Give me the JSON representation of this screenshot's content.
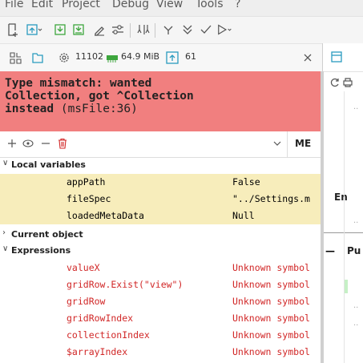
{
  "menu": {
    "items": [
      "File",
      "Edit",
      "Project",
      "Debug",
      "View",
      "Tools",
      "?"
    ]
  },
  "status": {
    "count": "11102",
    "memory": "64.9 MiB",
    "threads": "61"
  },
  "error": {
    "line1": "Type mismatch: wanted",
    "line2": "Collection, got ^Collection",
    "line3": "instead",
    "location": "(msFile:36)"
  },
  "panel": {
    "button_label": "ME"
  },
  "tree": {
    "local_header": "Local variables",
    "locals": [
      {
        "name": "appPath",
        "value": "False"
      },
      {
        "name": "fileSpec",
        "value": "\"../Settings.m"
      },
      {
        "name": "loadedMetaData",
        "value": "Null"
      }
    ],
    "current_header": "Current object",
    "expressions_header": "Expressions",
    "expressions": [
      {
        "name": "valueX",
        "value": "Unknown symbol"
      },
      {
        "name": "gridRow.Exist(\"view\")",
        "value": "Unknown symbol"
      },
      {
        "name": "gridRow",
        "value": "Unknown symbol"
      },
      {
        "name": "gridRowIndex",
        "value": "Unknown symbol"
      },
      {
        "name": "collectionIndex",
        "value": "Unknown symbol"
      },
      {
        "name": "$arrayIndex",
        "value": "Unknown symbol"
      }
    ]
  },
  "editor": {
    "fragment1": "En",
    "fragment2": "Pu",
    "dots": ".."
  },
  "colors": {
    "error_bg": "#f17f7f",
    "highlight_yellow": "#f7edbb",
    "symbol_red": "#d12727",
    "accent_teal": "#2a9bbf",
    "accent_green": "#3da63d"
  }
}
